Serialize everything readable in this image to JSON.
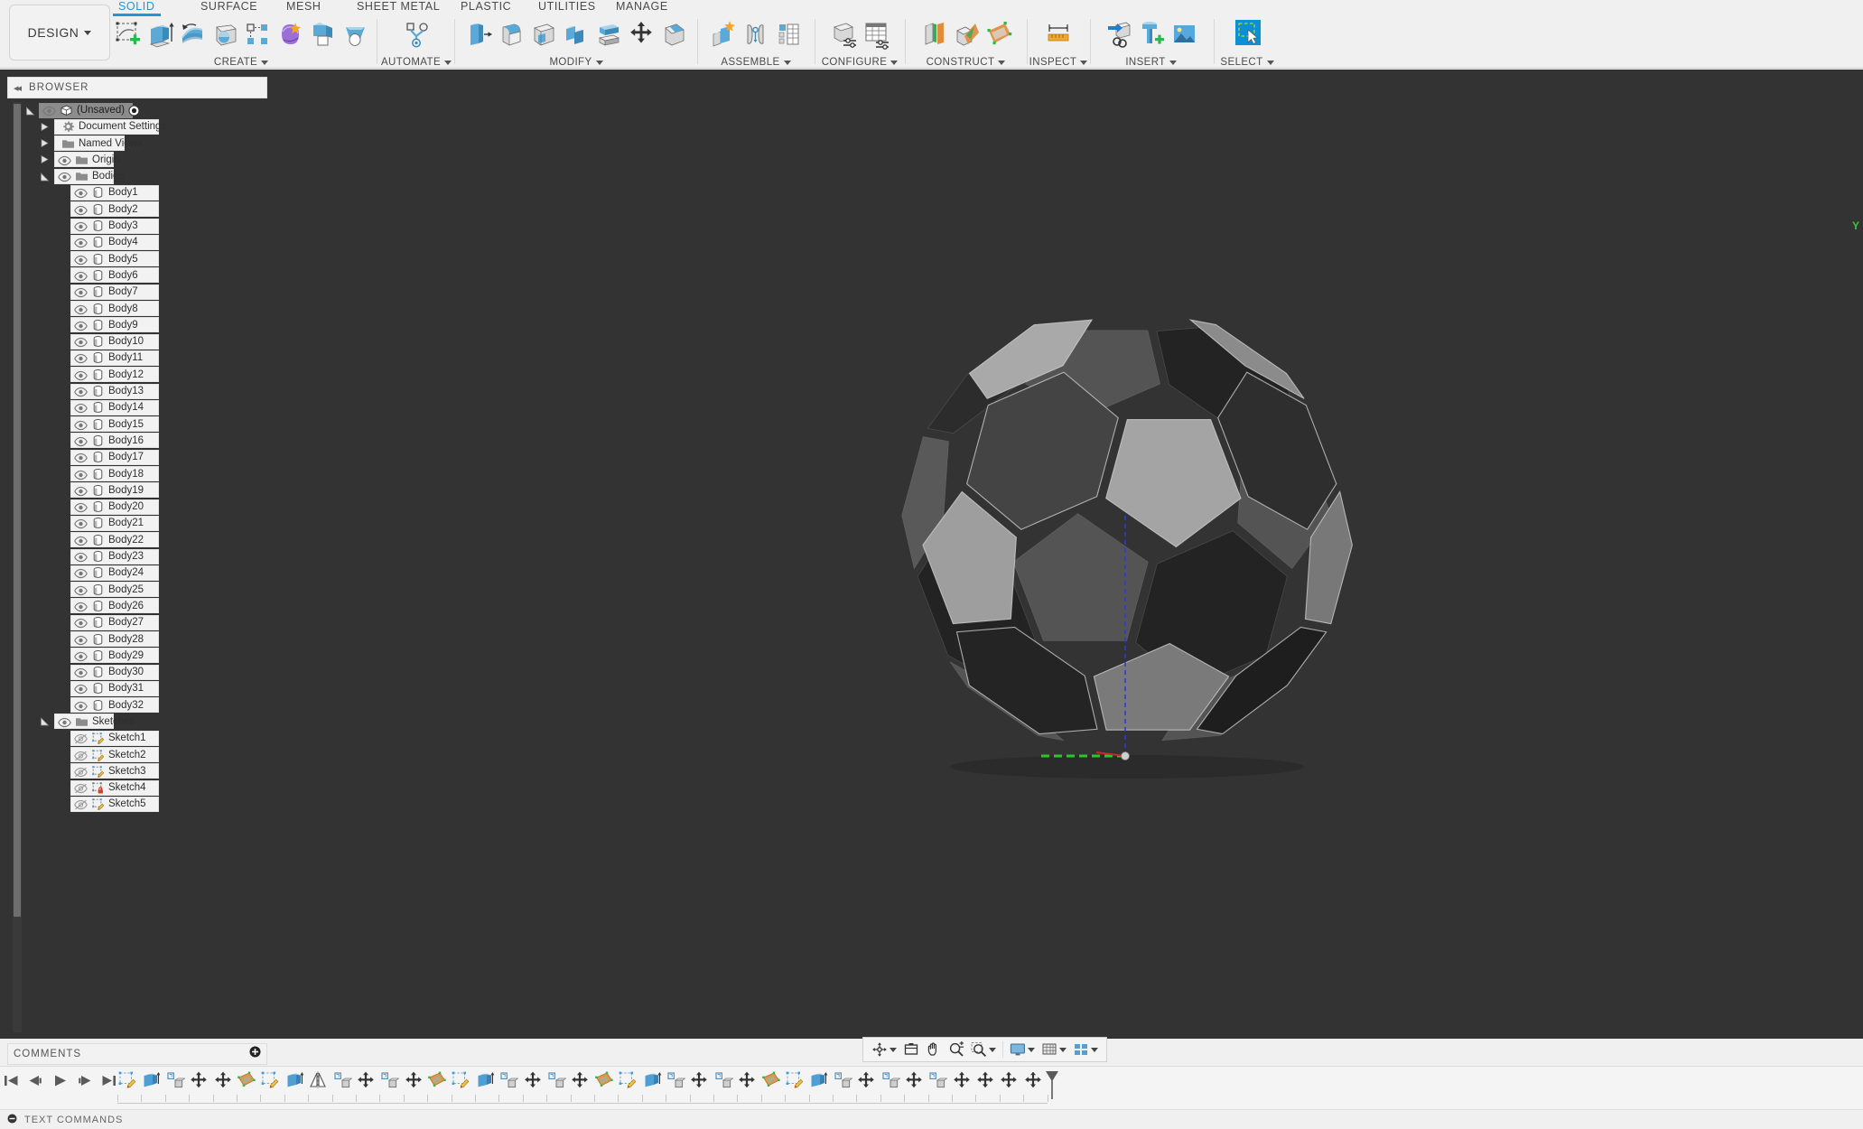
{
  "app": {
    "workspace_button": "DESIGN",
    "tabs": [
      {
        "label": "SOLID",
        "active": true
      },
      {
        "label": "SURFACE",
        "active": false
      },
      {
        "label": "MESH",
        "active": false
      },
      {
        "label": "SHEET METAL",
        "active": false
      },
      {
        "label": "PLASTIC",
        "active": false
      },
      {
        "label": "UTILITIES",
        "active": false
      },
      {
        "label": "MANAGE",
        "active": false
      }
    ],
    "tool_groups": [
      {
        "label": "CREATE",
        "icons": [
          "create-sketch-icon",
          "extrude-icon",
          "revolve-icon",
          "sweep-icon",
          "pattern-icon",
          "form-icon",
          "sheet-metal-flange-icon",
          "loft-icon"
        ]
      },
      {
        "label": "AUTOMATE",
        "icons": [
          "automate-icon"
        ]
      },
      {
        "label": "MODIFY",
        "icons": [
          "press-pull-icon",
          "fillet-icon",
          "shell-icon",
          "combine-icon",
          "split-face-icon",
          "move-copy-icon",
          "chamfer-icon"
        ]
      },
      {
        "label": "ASSEMBLE",
        "icons": [
          "new-component-icon",
          "joint-icon",
          "assemble-table-icon"
        ]
      },
      {
        "label": "CONFIGURE",
        "icons": [
          "configure-part-icon",
          "configure-table-icon"
        ]
      },
      {
        "label": "CONSTRUCT",
        "icons": [
          "offset-plane-icon",
          "plane-at-angle-icon",
          "plane-through-points-icon"
        ]
      },
      {
        "label": "INSPECT",
        "icons": [
          "measure-icon"
        ]
      },
      {
        "label": "INSERT",
        "icons": [
          "insert-derive-icon",
          "insert-mcmaster-icon",
          "insert-image-icon"
        ]
      },
      {
        "label": "SELECT",
        "icons": [
          "select-window-icon"
        ]
      }
    ]
  },
  "browser": {
    "title": "BROWSER",
    "collapse_icon": "collapse-left-icon",
    "nodes": [
      {
        "label": "(Unsaved)",
        "icon": "document-icon",
        "indent": 0,
        "expander": "expanded",
        "eye": true,
        "selected": true,
        "radio": true
      },
      {
        "label": "Document Settings",
        "icon": "gear-icon",
        "indent": 1,
        "expander": "collapsed",
        "eye": false,
        "selected": false,
        "radio": false
      },
      {
        "label": "Named Views",
        "icon": "folder-icon",
        "indent": 1,
        "expander": "collapsed",
        "eye": false,
        "selected": false,
        "radio": false
      },
      {
        "label": "Origin",
        "icon": "folder-icon",
        "indent": 1,
        "expander": "collapsed",
        "eye": true,
        "selected": false,
        "radio": false
      },
      {
        "label": "Bodies",
        "icon": "folder-icon",
        "indent": 1,
        "expander": "expanded",
        "eye": true,
        "selected": false,
        "radio": false
      },
      {
        "label": "Body1",
        "icon": "body-icon",
        "indent": 2,
        "expander": "none",
        "eye": true,
        "selected": false,
        "radio": false
      },
      {
        "label": "Body2",
        "icon": "body-icon",
        "indent": 2,
        "expander": "none",
        "eye": true,
        "selected": false,
        "radio": false
      },
      {
        "label": "Body3",
        "icon": "body-icon",
        "indent": 2,
        "expander": "none",
        "eye": true,
        "selected": false,
        "radio": false
      },
      {
        "label": "Body4",
        "icon": "body-icon",
        "indent": 2,
        "expander": "none",
        "eye": true,
        "selected": false,
        "radio": false
      },
      {
        "label": "Body5",
        "icon": "body-icon",
        "indent": 2,
        "expander": "none",
        "eye": true,
        "selected": false,
        "radio": false
      },
      {
        "label": "Body6",
        "icon": "body-icon",
        "indent": 2,
        "expander": "none",
        "eye": true,
        "selected": false,
        "radio": false
      },
      {
        "label": "Body7",
        "icon": "body-icon",
        "indent": 2,
        "expander": "none",
        "eye": true,
        "selected": false,
        "radio": false
      },
      {
        "label": "Body8",
        "icon": "body-icon",
        "indent": 2,
        "expander": "none",
        "eye": true,
        "selected": false,
        "radio": false
      },
      {
        "label": "Body9",
        "icon": "body-icon",
        "indent": 2,
        "expander": "none",
        "eye": true,
        "selected": false,
        "radio": false
      },
      {
        "label": "Body10",
        "icon": "body-icon",
        "indent": 2,
        "expander": "none",
        "eye": true,
        "selected": false,
        "radio": false
      },
      {
        "label": "Body11",
        "icon": "body-icon",
        "indent": 2,
        "expander": "none",
        "eye": true,
        "selected": false,
        "radio": false
      },
      {
        "label": "Body12",
        "icon": "body-icon",
        "indent": 2,
        "expander": "none",
        "eye": true,
        "selected": false,
        "radio": false
      },
      {
        "label": "Body13",
        "icon": "body-icon",
        "indent": 2,
        "expander": "none",
        "eye": true,
        "selected": false,
        "radio": false
      },
      {
        "label": "Body14",
        "icon": "body-icon",
        "indent": 2,
        "expander": "none",
        "eye": true,
        "selected": false,
        "radio": false
      },
      {
        "label": "Body15",
        "icon": "body-icon",
        "indent": 2,
        "expander": "none",
        "eye": true,
        "selected": false,
        "radio": false
      },
      {
        "label": "Body16",
        "icon": "body-icon",
        "indent": 2,
        "expander": "none",
        "eye": true,
        "selected": false,
        "radio": false
      },
      {
        "label": "Body17",
        "icon": "body-icon",
        "indent": 2,
        "expander": "none",
        "eye": true,
        "selected": false,
        "radio": false
      },
      {
        "label": "Body18",
        "icon": "body-icon",
        "indent": 2,
        "expander": "none",
        "eye": true,
        "selected": false,
        "radio": false
      },
      {
        "label": "Body19",
        "icon": "body-icon",
        "indent": 2,
        "expander": "none",
        "eye": true,
        "selected": false,
        "radio": false
      },
      {
        "label": "Body20",
        "icon": "body-icon",
        "indent": 2,
        "expander": "none",
        "eye": true,
        "selected": false,
        "radio": false
      },
      {
        "label": "Body21",
        "icon": "body-icon",
        "indent": 2,
        "expander": "none",
        "eye": true,
        "selected": false,
        "radio": false
      },
      {
        "label": "Body22",
        "icon": "body-icon",
        "indent": 2,
        "expander": "none",
        "eye": true,
        "selected": false,
        "radio": false
      },
      {
        "label": "Body23",
        "icon": "body-icon",
        "indent": 2,
        "expander": "none",
        "eye": true,
        "selected": false,
        "radio": false
      },
      {
        "label": "Body24",
        "icon": "body-icon",
        "indent": 2,
        "expander": "none",
        "eye": true,
        "selected": false,
        "radio": false
      },
      {
        "label": "Body25",
        "icon": "body-icon",
        "indent": 2,
        "expander": "none",
        "eye": true,
        "selected": false,
        "radio": false
      },
      {
        "label": "Body26",
        "icon": "body-icon",
        "indent": 2,
        "expander": "none",
        "eye": true,
        "selected": false,
        "radio": false
      },
      {
        "label": "Body27",
        "icon": "body-icon",
        "indent": 2,
        "expander": "none",
        "eye": true,
        "selected": false,
        "radio": false
      },
      {
        "label": "Body28",
        "icon": "body-icon",
        "indent": 2,
        "expander": "none",
        "eye": true,
        "selected": false,
        "radio": false
      },
      {
        "label": "Body29",
        "icon": "body-icon",
        "indent": 2,
        "expander": "none",
        "eye": true,
        "selected": false,
        "radio": false
      },
      {
        "label": "Body30",
        "icon": "body-icon",
        "indent": 2,
        "expander": "none",
        "eye": true,
        "selected": false,
        "radio": false
      },
      {
        "label": "Body31",
        "icon": "body-icon",
        "indent": 2,
        "expander": "none",
        "eye": true,
        "selected": false,
        "radio": false
      },
      {
        "label": "Body32",
        "icon": "body-icon",
        "indent": 2,
        "expander": "none",
        "eye": true,
        "selected": false,
        "radio": false
      },
      {
        "label": "Sketches",
        "icon": "folder-icon",
        "indent": 1,
        "expander": "expanded",
        "eye": true,
        "selected": false,
        "radio": false
      },
      {
        "label": "Sketch1",
        "icon": "sketch-icon",
        "indent": 2,
        "expander": "none",
        "eye": "hidden",
        "selected": false,
        "radio": false
      },
      {
        "label": "Sketch2",
        "icon": "sketch-icon",
        "indent": 2,
        "expander": "none",
        "eye": "hidden",
        "selected": false,
        "radio": false
      },
      {
        "label": "Sketch3",
        "icon": "sketch-icon",
        "indent": 2,
        "expander": "none",
        "eye": "hidden",
        "selected": false,
        "radio": false
      },
      {
        "label": "Sketch4",
        "icon": "sketch-locked-icon",
        "indent": 2,
        "expander": "none",
        "eye": "hidden",
        "selected": false,
        "radio": false
      },
      {
        "label": "Sketch5",
        "icon": "sketch-icon",
        "indent": 2,
        "expander": "none",
        "eye": "hidden",
        "selected": false,
        "radio": false
      }
    ]
  },
  "comments": {
    "title": "COMMENTS",
    "add_icon": "add-comment-icon"
  },
  "viewport": {
    "axis_label": "Y",
    "background_color": "#333333",
    "model_name": "truncated-icosahedron-soccer-ball"
  },
  "view_toolbar": {
    "items": [
      {
        "name": "orbit-icon",
        "has_caret": true
      },
      {
        "name": "look-at-icon",
        "has_caret": false
      },
      {
        "name": "pan-icon",
        "has_caret": false
      },
      {
        "name": "zoom-icon",
        "has_caret": false
      },
      {
        "name": "fit-icon",
        "has_caret": true
      },
      {
        "name": "display-settings-icon",
        "has_caret": true
      },
      {
        "name": "grid-snap-icon",
        "has_caret": true
      },
      {
        "name": "viewports-icon",
        "has_caret": true
      }
    ]
  },
  "timeline": {
    "playback": [
      "go-to-beginning-icon",
      "step-back-icon",
      "play-icon",
      "step-forward-icon",
      "go-to-end-icon"
    ],
    "features": [
      "sketch-icon",
      "extrude-icon",
      "pattern-icon",
      "move-icon",
      "move-icon",
      "plane-icon",
      "sketch-icon",
      "extrude-icon",
      "mirror-icon",
      "pattern-icon",
      "move-icon",
      "pattern-icon",
      "move-icon",
      "plane-icon",
      "sketch-icon",
      "extrude-icon",
      "pattern-icon",
      "move-icon",
      "pattern-icon",
      "move-icon",
      "plane-icon",
      "sketch-icon",
      "extrude-icon",
      "pattern-icon",
      "move-icon",
      "pattern-icon",
      "move-icon",
      "plane-icon",
      "sketch-icon",
      "extrude-icon",
      "pattern-icon",
      "move-icon",
      "pattern-icon",
      "move-icon",
      "pattern-icon",
      "move-icon",
      "move-icon",
      "move-icon",
      "move-icon"
    ],
    "end_marker_icon": "timeline-marker-icon"
  },
  "text_commands": {
    "title": "TEXT COMMANDS",
    "toggle_icon": "collapse-icon"
  }
}
